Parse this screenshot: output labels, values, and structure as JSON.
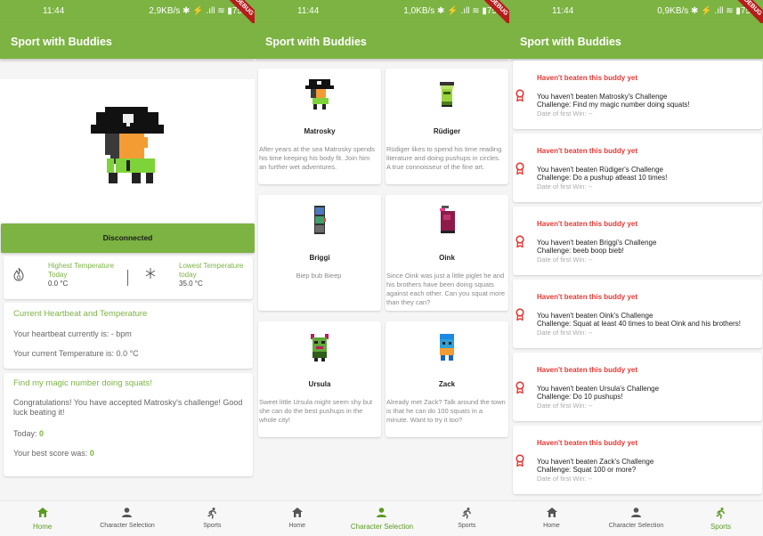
{
  "colors": {
    "primary": "#7cb342",
    "accent_red": "#e53935"
  },
  "screens": [
    {
      "status": {
        "time": "11:44",
        "right": "2,9KB/s ✱ ⚡ .ıll ≋ ▮75"
      }
    },
    {
      "status": {
        "time": "11:44",
        "right": "1,0KB/s ✱ ⚡ .ıll ≋ ▮75"
      }
    },
    {
      "status": {
        "time": "11:44",
        "right": "0,9KB/s ✱ ⚡ .ıll ≋ ▮75"
      }
    }
  ],
  "debug_label": "DEBUG",
  "app_title": "Sport with Buddies",
  "nav": {
    "home": "Home",
    "character": "Character Selection",
    "sports": "Sports"
  },
  "home": {
    "connection_button": "Disconnected",
    "highest": {
      "label": "Highest Temperature Today",
      "value": "0.0 °C",
      "icon": "flame-icon"
    },
    "lowest": {
      "label": "Lowest Temperature today",
      "value": "35.0 °C",
      "icon": "snowflake-icon"
    },
    "heartbeat": {
      "title": "Current Heartbeat and Temperature",
      "heartbeat_text": "Your heartbeat currently is: - bpm",
      "temperature_text": "Your current Temperature is: 0.0 °C"
    },
    "squats": {
      "title": "Find my magic number doing squats!",
      "message": "Congratulations! You have accepted Matrosky's challenge! Good luck beating it!",
      "today_label": "Today: ",
      "today_value": "0",
      "best_label": "Your best score was: ",
      "best_value": "0"
    }
  },
  "characters": [
    {
      "name": "Matrosky",
      "description": "After years at the sea Matrosky spends his time keeping his body fit. Join him an further wet adventures."
    },
    {
      "name": "Rüdiger",
      "description": "Rüdiger likes to spend his time reading literature and doing pushups in circles. A true connoisseur of the fine art."
    },
    {
      "name": "Briggi",
      "description": "Biep bub Bieep"
    },
    {
      "name": "Oink",
      "description": "Since Oink was just a little piglet he and his brothers have been doing squats against each other. Can you squat more than they can?"
    },
    {
      "name": "Ursula",
      "description": "Sweet little Ursula might seem shy but she can do the best pushups in the whole city!"
    },
    {
      "name": "Zack",
      "description": "Already met Zack? Talk around the town is that he can do 100 squats in a minute. Want to try it too?"
    }
  ],
  "challenges": [
    {
      "title": "Haven't beaten this buddy yet",
      "line1": "You haven't beaten Matrosky's Challenge",
      "line2": "Challenge: Find my magic number doing squats!",
      "line3": "Date of first Win: --"
    },
    {
      "title": "Haven't beaten this buddy yet",
      "line1": "You haven't beaten Rüdiger's Challenge",
      "line2": "Challenge: Do a pushup atleast 10 times!",
      "line3": "Date of first Win: --"
    },
    {
      "title": "Haven't beaten this buddy yet",
      "line1": "You haven't beaten Briggi's Challenge",
      "line2": "Challenge: beeb boop bieb!",
      "line3": "Date of first Win: --"
    },
    {
      "title": "Haven't beaten this buddy yet",
      "line1": "You haven't beaten Oink's Challenge",
      "line2": "Challenge: Squat at least 40 times to beat Oink and his brothers!",
      "line3": "Date of first Win: --"
    },
    {
      "title": "Haven't beaten this buddy yet",
      "line1": "You haven't beaten Ursula's Challenge",
      "line2": "Challenge: Do 10 pushups!",
      "line3": "Date of first Win: --"
    },
    {
      "title": "Haven't beaten this buddy yet",
      "line1": "You haven't beaten Zack's Challenge",
      "line2": "Challenge: Squat 100 or more?",
      "line3": "Date of first Win: --"
    }
  ]
}
